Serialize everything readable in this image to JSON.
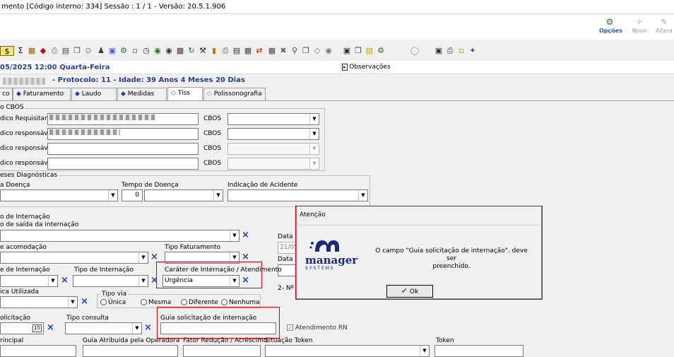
{
  "window": {
    "title": "mento [Código interno: 334]  Sessão : 1 / 1 - Versão: 20.5.1.906"
  },
  "top_buttons": [
    {
      "label": "Opções",
      "icon": "options-icon",
      "color": "#1f5fbf"
    },
    {
      "label": "Novo",
      "icon": "new-icon",
      "color": "#9a9a9a"
    },
    {
      "label": "Altera",
      "icon": "edit-icon",
      "color": "#9a9a9a"
    }
  ],
  "info": {
    "datetime": "05/2025 12:00  Quarta-Feira",
    "observacoes": "Observações",
    "patient_line": "- Protocolo: 11 - Idade: 39 Anos 4 Meses 20 Dias"
  },
  "tabs": [
    {
      "label": "co"
    },
    {
      "label": "Faturamento"
    },
    {
      "label": "Laudo"
    },
    {
      "label": "Medidas"
    },
    {
      "label": "Tiss"
    },
    {
      "label": "Polissonografia"
    }
  ],
  "cbos_group": {
    "title": "o CBOS",
    "rows": [
      {
        "label": "dico Requisitante",
        "cbos": "CBOS"
      },
      {
        "label": "dico responsável",
        "cbos": "CBOS"
      },
      {
        "label": "dico responsável",
        "cbos": "CBOS"
      },
      {
        "label": "dico responsável",
        "cbos": "CBOS"
      }
    ]
  },
  "diag_group": {
    "title": "eses Diagnósticas",
    "tipo_doenca": "a Doença",
    "tempo_doenca": "Tempo de Doença",
    "tempo_value": "0",
    "indicacao": "Indicação de Acidente"
  },
  "internacao": {
    "title": "o de Internação",
    "saida_label": "o de saída da internação",
    "acomodacao": "e acomodação",
    "tipo_faturamento": "Tipo Faturamento",
    "regime": "e de Internação",
    "tipo_internacao": "Tipo de Internação",
    "carater": "Caráter de Internação / Atendimento",
    "carater_value": "Urgência",
    "data_label": "Data i",
    "data_value": "21/05",
    "data_s": "Data s",
    "numero": "2- Nº G",
    "tecnica": "ica Utilizada",
    "tipo_via": "Tipo via",
    "via_options": [
      "Única",
      "Mesma",
      "Diferente",
      "Nenhuma"
    ],
    "solicitacao": "olicitação",
    "tipo_consulta": "Tipo consulta",
    "guia_solicitacao": "Guia solicitação de internação",
    "atendimento_rn": "Atendimento RN",
    "principal": "rincipal",
    "guia_operadora": "Guia Atribuída pela Operadora",
    "fator": "Fator Redução / Acréscimo",
    "situacao_token": "Situação Token",
    "token": "Token"
  },
  "dialog": {
    "title": "Atenção",
    "message_l1": "O campo \"Guia solicitação de internação\". deve ser",
    "message_l2": "preenchido.",
    "ok_label": "Ok",
    "logo_word": "manager",
    "logo_sub": "SYSTEMS"
  }
}
